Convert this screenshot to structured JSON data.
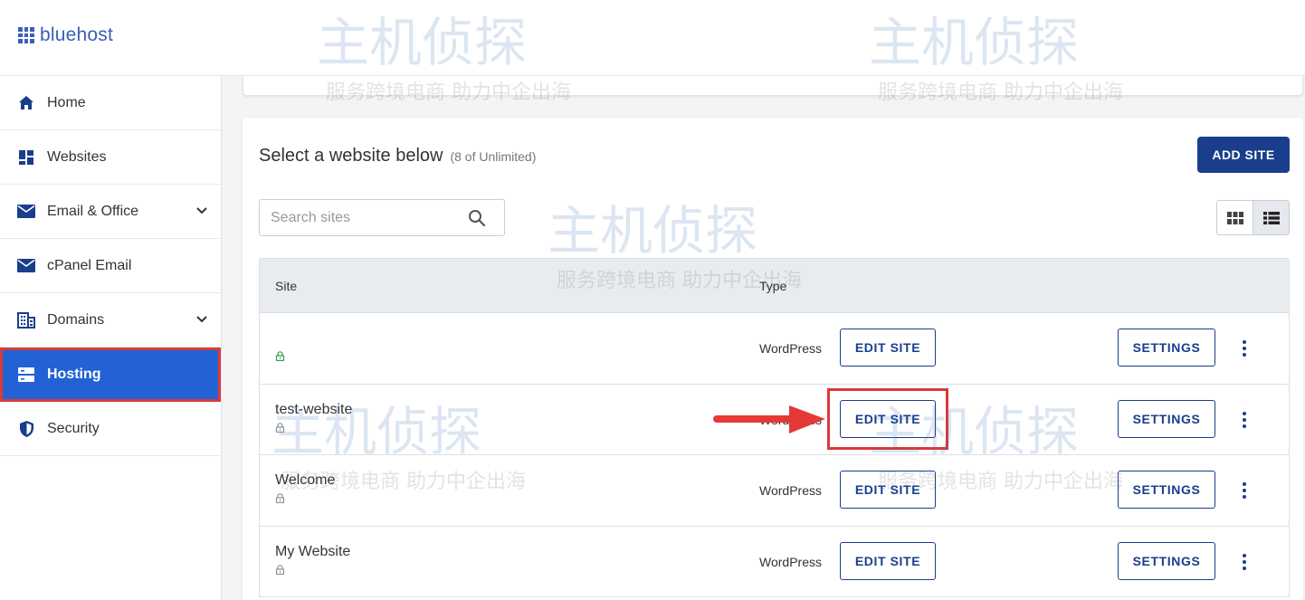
{
  "brand": {
    "name": "bluehost"
  },
  "sidebar": {
    "items": [
      {
        "label": "Home",
        "icon": "home-icon",
        "active": false,
        "expandable": false
      },
      {
        "label": "Websites",
        "icon": "websites-icon",
        "active": false,
        "expandable": false
      },
      {
        "label": "Email & Office",
        "icon": "envelope-icon",
        "active": false,
        "expandable": true
      },
      {
        "label": "cPanel Email",
        "icon": "envelope-icon",
        "active": false,
        "expandable": false
      },
      {
        "label": "Domains",
        "icon": "domains-icon",
        "active": false,
        "expandable": true
      },
      {
        "label": "Hosting",
        "icon": "server-icon",
        "active": true,
        "expandable": false
      },
      {
        "label": "Security",
        "icon": "shield-icon",
        "active": false,
        "expandable": false
      }
    ]
  },
  "main": {
    "title": "Select a website below",
    "subtitle": "(8 of Unlimited)",
    "add_site_label": "ADD SITE",
    "search": {
      "placeholder": "Search sites",
      "value": ""
    },
    "view_mode": "list",
    "table": {
      "headers": {
        "site": "Site",
        "type": "Type"
      },
      "rows": [
        {
          "name": "",
          "type": "WordPress",
          "lock_color": "#2e9b4a",
          "edit_label": "EDIT SITE",
          "settings_label": "SETTINGS"
        },
        {
          "name": "test-website",
          "type": "WordPress",
          "lock_color": "#8a8f96",
          "edit_label": "EDIT SITE",
          "settings_label": "SETTINGS"
        },
        {
          "name": "Welcome",
          "type": "WordPress",
          "lock_color": "#8a8f96",
          "edit_label": "EDIT SITE",
          "settings_label": "SETTINGS"
        },
        {
          "name": "My Website",
          "type": "WordPress",
          "lock_color": "#8a8f96",
          "edit_label": "EDIT SITE",
          "settings_label": "SETTINGS"
        }
      ]
    }
  },
  "annotation": {
    "highlight_color": "#d93a3a",
    "arrow_color": "#e53935"
  },
  "watermark": {
    "main": "主机侦探",
    "tagline": "服务跨境电商 助力中企出海"
  },
  "colors": {
    "primary": "#1a3e8c",
    "active_nav": "#2262d4",
    "brand": "#3a5eb8"
  }
}
